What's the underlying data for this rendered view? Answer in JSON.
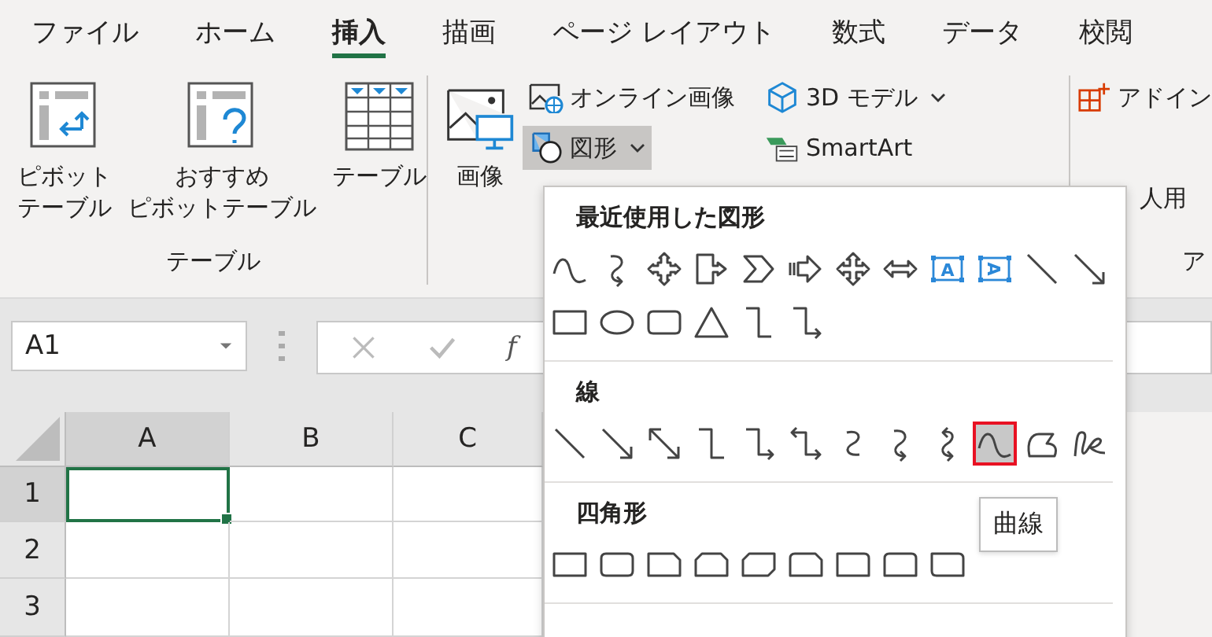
{
  "tabs": [
    {
      "label": "ファイル",
      "selected": false
    },
    {
      "label": "ホーム",
      "selected": false
    },
    {
      "label": "挿入",
      "selected": true
    },
    {
      "label": "描画",
      "selected": false
    },
    {
      "label": "ページ レイアウト",
      "selected": false
    },
    {
      "label": "数式",
      "selected": false
    },
    {
      "label": "データ",
      "selected": false
    },
    {
      "label": "校閲",
      "selected": false
    }
  ],
  "ribbon": {
    "table_group": {
      "label": "テーブル",
      "buttons": [
        {
          "kind": "pivot-table",
          "lines": [
            "ピボット",
            "テーブル"
          ]
        },
        {
          "kind": "recommended-pivot",
          "lines": [
            "おすすめ",
            "ピボットテーブル"
          ]
        },
        {
          "kind": "table",
          "lines": [
            "テーブル"
          ]
        }
      ]
    },
    "illustrations": {
      "large": {
        "kind": "picture",
        "lines": [
          "画像"
        ]
      },
      "small": [
        {
          "kind": "online-picture",
          "label": "オンライン画像",
          "dropdown": false,
          "selected": false
        },
        {
          "kind": "cube",
          "label": "3D モデル",
          "dropdown": true,
          "selected": false
        },
        {
          "kind": "shapes",
          "label": "図形",
          "dropdown": true,
          "selected": true
        },
        {
          "kind": "smartart",
          "label": "SmartArt",
          "dropdown": false,
          "selected": false
        }
      ]
    },
    "addins": {
      "label": "ア",
      "items": [
        {
          "kind": "icon-label",
          "label": "アドイン"
        },
        {
          "kind": "text",
          "label": "人用"
        }
      ]
    }
  },
  "formula_bar": {
    "name_box": "A1",
    "fx": "f"
  },
  "grid": {
    "columns": [
      {
        "label": "A",
        "selected": true
      },
      {
        "label": "B",
        "selected": false
      },
      {
        "label": "C",
        "selected": false
      }
    ],
    "rows": [
      {
        "label": "1",
        "selected": true
      },
      {
        "label": "2",
        "selected": false
      },
      {
        "label": "3",
        "selected": false
      }
    ]
  },
  "shapes_menu": {
    "tooltip": "曲線",
    "sections": [
      {
        "title": "最近使用した図形",
        "shapes": [
          {
            "kind": "curve",
            "selected": false
          },
          {
            "kind": "curved-arrow",
            "selected": false
          },
          {
            "kind": "quad-arrow-callout",
            "selected": false
          },
          {
            "kind": "arrow-callout",
            "selected": false
          },
          {
            "kind": "chevron",
            "selected": false
          },
          {
            "kind": "striped-arrow",
            "selected": false
          },
          {
            "kind": "quad-arrow",
            "selected": false
          },
          {
            "kind": "left-right-arrow",
            "selected": false
          },
          {
            "kind": "textbox",
            "glyph": "A",
            "selected": false
          },
          {
            "kind": "vertical-textbox",
            "glyph": "A",
            "selected": false
          },
          {
            "kind": "line",
            "selected": false
          },
          {
            "kind": "line-arrow",
            "selected": false
          },
          {
            "kind": "rectangle",
            "selected": false
          },
          {
            "kind": "oval",
            "selected": false
          },
          {
            "kind": "rounded-rectangle",
            "selected": false
          },
          {
            "kind": "triangle",
            "selected": false
          },
          {
            "kind": "elbow",
            "selected": false
          },
          {
            "kind": "elbow-arrow",
            "selected": false
          }
        ]
      },
      {
        "title": "線",
        "shapes": [
          {
            "kind": "line",
            "selected": false
          },
          {
            "kind": "line-arrow",
            "selected": false
          },
          {
            "kind": "line-double-arrow",
            "selected": false
          },
          {
            "kind": "elbow",
            "selected": false
          },
          {
            "kind": "elbow-arrow",
            "selected": false
          },
          {
            "kind": "elbow-double-arrow",
            "selected": false
          },
          {
            "kind": "curved-connector",
            "selected": false
          },
          {
            "kind": "curved-arrow",
            "selected": false
          },
          {
            "kind": "curved-double-arrow",
            "selected": false
          },
          {
            "kind": "curve",
            "selected": true
          },
          {
            "kind": "freeform",
            "selected": false
          },
          {
            "kind": "scribble",
            "selected": false
          }
        ]
      },
      {
        "title": "四角形",
        "shapes": [
          {
            "kind": "rectangle",
            "selected": false
          },
          {
            "kind": "rounded-rectangle",
            "selected": false
          },
          {
            "kind": "snip-corner-rectangle",
            "selected": false
          },
          {
            "kind": "snip-same-side-rectangle",
            "selected": false
          },
          {
            "kind": "snip-diagonal-rectangle",
            "selected": false
          },
          {
            "kind": "snip-round-rectangle",
            "selected": false
          },
          {
            "kind": "round-corner-rectangle",
            "selected": false
          },
          {
            "kind": "round-same-side-rectangle",
            "selected": false
          },
          {
            "kind": "round-diagonal-rectangle",
            "selected": false
          }
        ]
      }
    ]
  }
}
